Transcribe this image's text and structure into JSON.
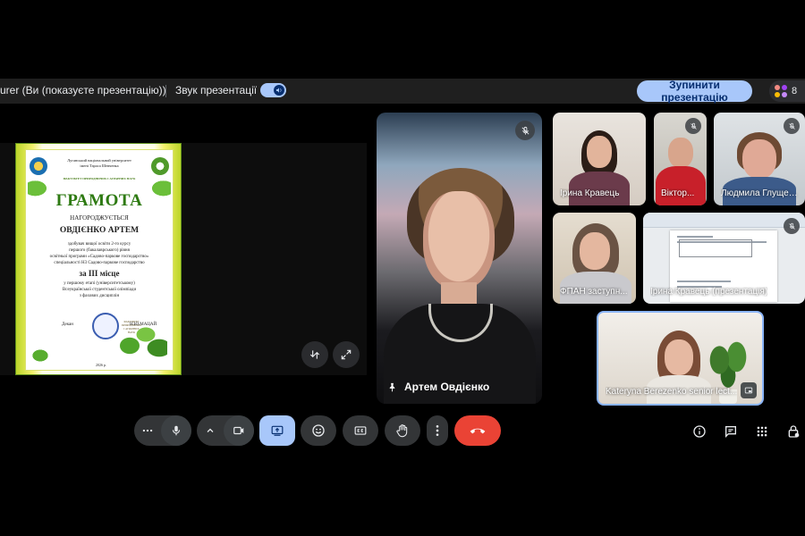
{
  "presentation_bar": {
    "status_text": "urer (Ви (показуєте презентацію))",
    "audio_label": "Звук презентації",
    "stop_button": "Зупинити презентацію",
    "participant_count": "8"
  },
  "shared_screen": {
    "certificate": {
      "university_line1": "Луганський національний університет",
      "university_line2": "імені Тараса Шевченка",
      "faculty": "ФАКУЛЬТЕТ ПРИРОДНИЧИХ І АГРАРНИХ НАУК",
      "title": "ГРАМОТА",
      "awarded": "НАГОРОДЖУЄТЬСЯ",
      "recipient": "ОВДІЄНКО АРТЕМ",
      "line1": "здобувач вищої освіти 2-го курсу",
      "line2": "першого (бакалаврського) рівня",
      "line3": "освітньої програми «Садово-паркове господарство»",
      "line4": "спеціальності Н3 Садово-паркове господарство",
      "place": "за ІІІ місце",
      "line5": "у першому етапі (університетському)",
      "line6": "Всеукраїнської студентської олімпіади",
      "line7": "з фахових дисциплін",
      "dean_label": "Декан",
      "dean_name": "Н.Ю.МАЦАЙ",
      "seal_text": "ФАКУЛЬТЕТ ПРИРОДНИЧИХ І АГРАРНИХ НАУК",
      "city_year": "2026 р."
    }
  },
  "main_speaker": {
    "name": "Артем Овдієнко"
  },
  "participants": [
    {
      "name": "Ірина Кравець"
    },
    {
      "name": "Віктор..."
    },
    {
      "name": "Людмила Глущен..."
    },
    {
      "name": "ФПАН заступн..."
    },
    {
      "name": "Ірина Кравець (презентація)"
    },
    {
      "name": "Kateryna Berezenko senior lect..."
    }
  ],
  "colors": {
    "accent": "#a8c7fa",
    "leave": "#ea4335",
    "background": "#000000",
    "control": "#333537"
  },
  "icons": {
    "more": "more-horizontal-icon",
    "mic": "mic-icon",
    "chevron": "chevron-up-icon",
    "camera": "videocam-icon",
    "present": "present-to-all-icon",
    "reactions": "emoji-icon",
    "captions": "closed-captions-icon",
    "hand": "raise-hand-icon",
    "overflow": "more-vertical-icon",
    "leave": "call-end-icon",
    "info": "info-icon",
    "chat": "chat-icon",
    "activities": "apps-icon",
    "host": "host-controls-icon"
  }
}
